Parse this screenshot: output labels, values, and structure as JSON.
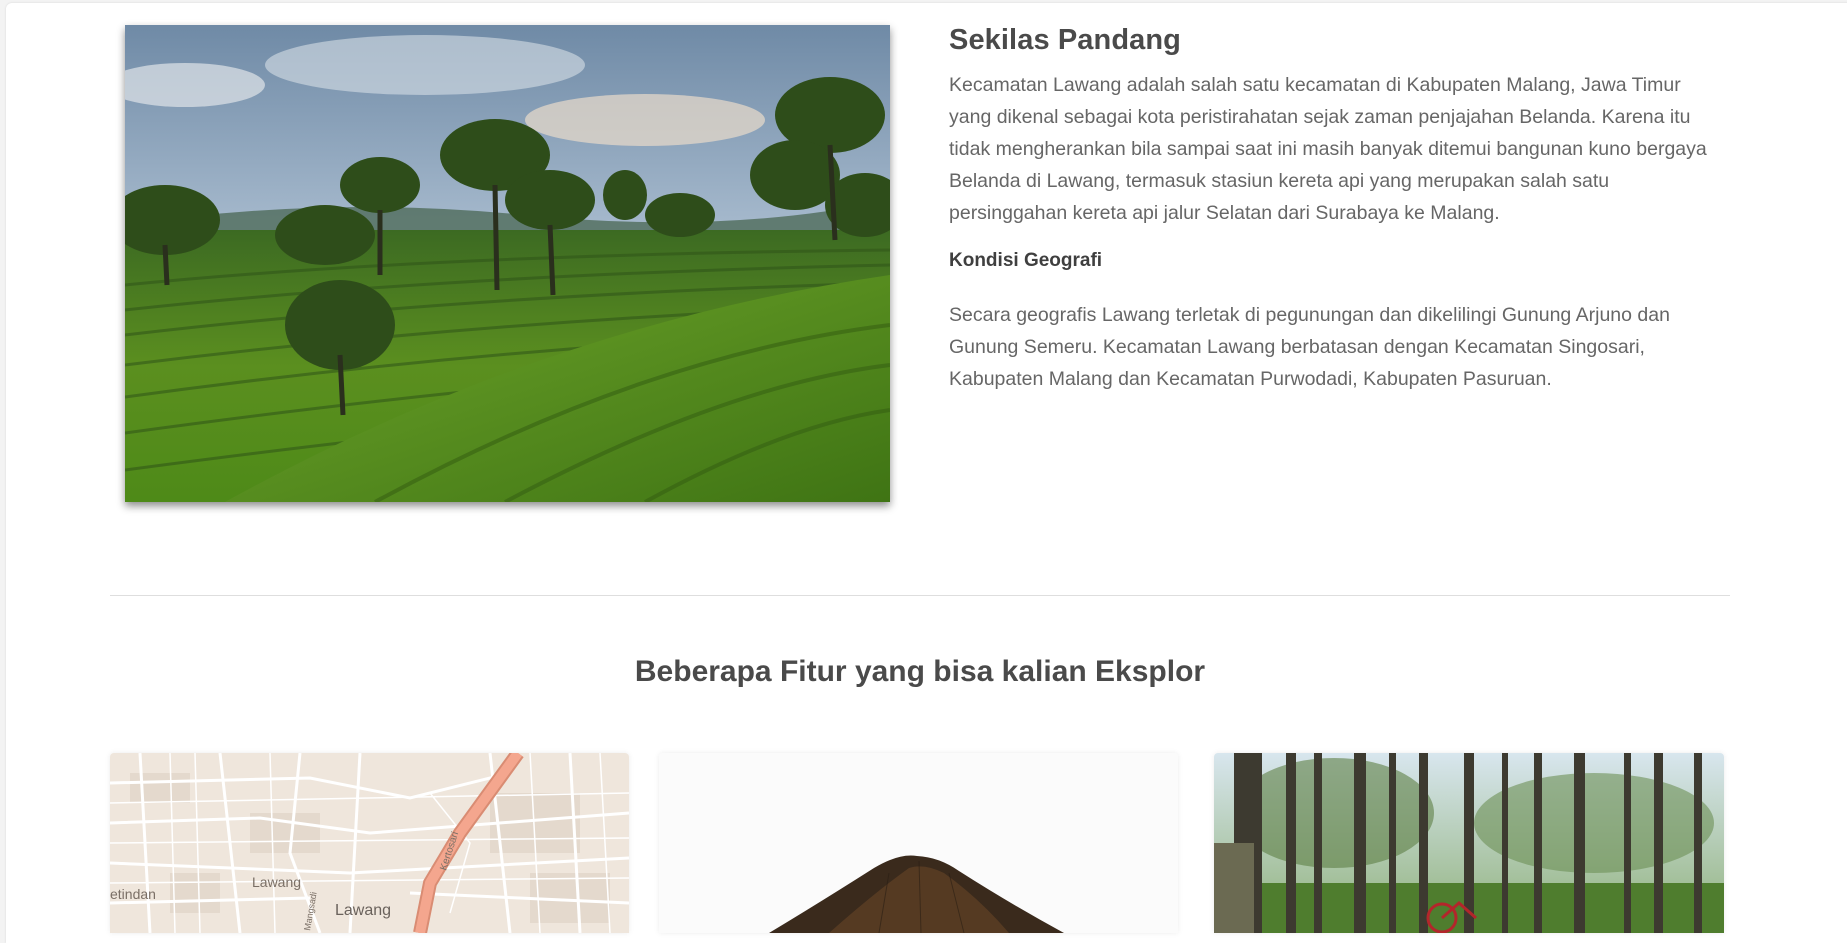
{
  "overview": {
    "title": "Sekilas Pandang",
    "intro": "Kecamatan Lawang adalah salah satu kecamatan di Kabupaten Malang, Jawa Timur yang dikenal sebagai kota peristirahatan sejak zaman penjajahan Belanda. Karena itu tidak mengherankan bila sampai saat ini masih banyak ditemui bangunan kuno bergaya Belanda di Lawang, termasuk stasiun kereta api yang merupakan salah satu persinggahan kereta api jalur Selatan dari Surabaya ke Malang.",
    "subheading": "Kondisi Geografi",
    "geography": "Secara geografis Lawang terletak di pegunungan dan dikelilingi Gunung Arjuno dan Gunung Semeru. Kecamatan Lawang berbatasan dengan Kecamatan Singosari, Kabupaten Malang dan Kecamatan Purwodadi, Kabupaten Pasuruan."
  },
  "hero_image": {
    "subject": "tea plantation landscape"
  },
  "features": {
    "title": "Beberapa Fitur yang bisa kalian Eksplor",
    "cards": [
      {
        "image": "map",
        "map_labels": [
          "Lawang",
          "Lawang",
          "etindan",
          "Kertosari",
          "Mangsadi"
        ]
      },
      {
        "image": "mountain"
      },
      {
        "image": "forest"
      }
    ]
  },
  "colors": {
    "heading": "#4a4a4a",
    "body_text": "#666666",
    "divider": "#dedede",
    "map_road": "#f4a68e",
    "map_background": "#efe6dc"
  }
}
